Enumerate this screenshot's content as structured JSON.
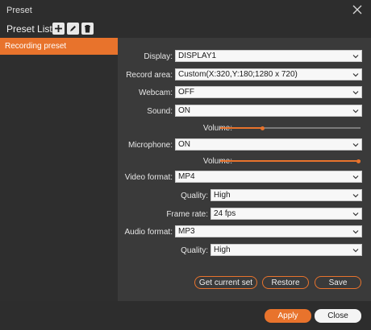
{
  "window": {
    "title": "Preset"
  },
  "preset_list": {
    "label": "Preset List"
  },
  "sidebar": {
    "items": [
      {
        "label": "Recording preset"
      }
    ]
  },
  "settings": {
    "display": {
      "label": "Display:",
      "value": "DISPLAY1"
    },
    "record_area": {
      "label": "Record area:",
      "value": "Custom(X:320,Y:180;1280 x 720)"
    },
    "webcam": {
      "label": "Webcam:",
      "value": "OFF"
    },
    "sound": {
      "label": "Sound:",
      "value": "ON"
    },
    "sound_volume": {
      "label": "Volume:",
      "level": 0.3
    },
    "microphone": {
      "label": "Microphone:",
      "value": "ON"
    },
    "mic_volume": {
      "label": "Volume:",
      "level": 1.0
    },
    "video_format": {
      "label": "Video format:",
      "value": "MP4"
    },
    "video_quality": {
      "label": "Quality:",
      "value": "High"
    },
    "frame_rate": {
      "label": "Frame rate:",
      "value": "24 fps"
    },
    "audio_format": {
      "label": "Audio format:",
      "value": "MP3"
    },
    "audio_quality": {
      "label": "Quality:",
      "value": "High"
    }
  },
  "actions": {
    "get_current_set": "Get current set",
    "restore": "Restore",
    "save": "Save"
  },
  "footer": {
    "apply": "Apply",
    "close": "Close"
  },
  "colors": {
    "accent": "#e8732c",
    "panel": "#2d2d2d",
    "background": "#3a3a3a"
  }
}
